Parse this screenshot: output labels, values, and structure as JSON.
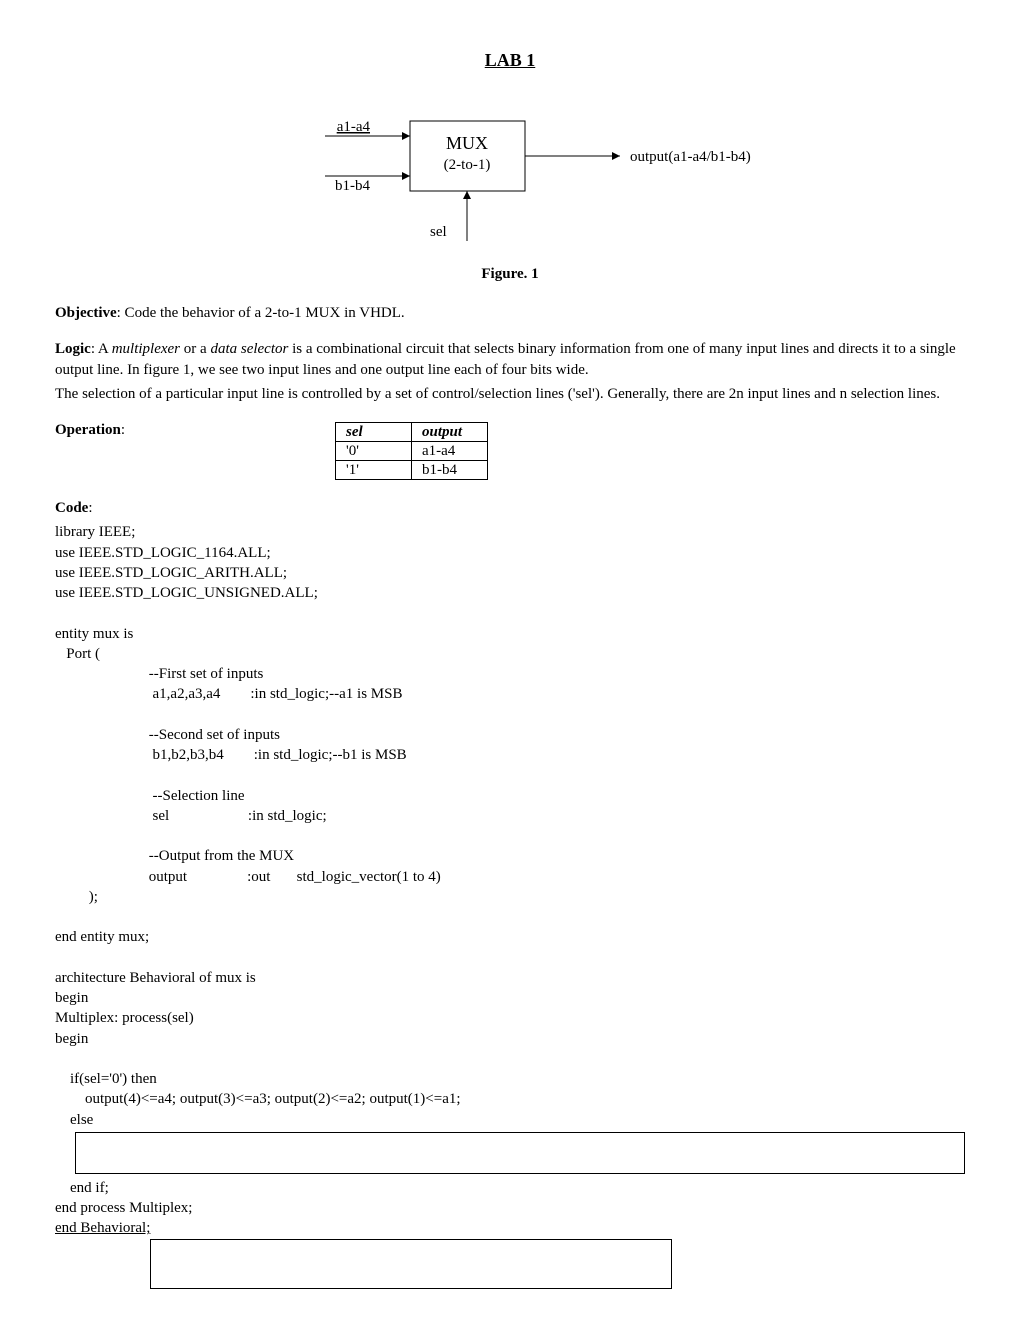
{
  "title": "LAB 1",
  "diagram": {
    "input_top": "a1-a4",
    "input_bottom": "b1-b4",
    "box_line1": "MUX",
    "box_line2": "(2-to-1)",
    "output": "output(a1-a4/b1-b4)",
    "sel": "sel"
  },
  "figure_caption": "Figure. 1",
  "objective_label": "Objective",
  "objective_text": ": Code the behavior of a 2-to-1 MUX in VHDL.",
  "logic_label": "Logic",
  "logic_text_1": ": A ",
  "logic_italic_1": "multiplexer",
  "logic_text_2": " or a ",
  "logic_italic_2": "data selector",
  "logic_text_3": " is a combinational circuit that selects binary information from one of many input lines and directs it to a single output line. In figure 1, we see two input lines and one output line each of four bits wide.",
  "logic_text_4": "The selection of a particular input line is controlled by a set of control/selection lines ('sel'). Generally, there are 2n input lines and n selection lines.",
  "operation_label": "Operation",
  "table": {
    "h1": "sel",
    "h2": "output",
    "r1c1": "'0'",
    "r1c2": "a1-a4",
    "r2c1": "'1'",
    "r2c2": "b1-b4"
  },
  "code_label": "Code",
  "code": {
    "l1": "library IEEE;",
    "l2": "use IEEE.STD_LOGIC_1164.ALL;",
    "l3": "use IEEE.STD_LOGIC_ARITH.ALL;",
    "l4": "use IEEE.STD_LOGIC_UNSIGNED.ALL;",
    "l5": "entity mux is",
    "l6": "   Port (",
    "l7": "                         --First set of inputs",
    "l8": "                          a1,a2,a3,a4        :in std_logic;--a1 is MSB",
    "l9": "                         --Second set of inputs",
    "l10": "                          b1,b2,b3,b4        :in std_logic;--b1 is MSB",
    "l11": "                          --Selection line",
    "l12": "                          sel                     :in std_logic;",
    "l13": "                         --Output from the MUX",
    "l14": "                         output                :out       std_logic_vector(1 to 4)",
    "l15": "         );",
    "l16": "end entity mux;",
    "l17": "architecture Behavioral of mux is",
    "l18": "begin",
    "l19": "Multiplex: process(sel)",
    "l20": "begin",
    "l21": "    if(sel='0') then",
    "l22": "        output(4)<=a4; output(3)<=a3; output(2)<=a2; output(1)<=a1;",
    "l23": "    else",
    "l24": "    end if;",
    "l25": "end process Multiplex;",
    "l26": "end Behavioral;"
  }
}
